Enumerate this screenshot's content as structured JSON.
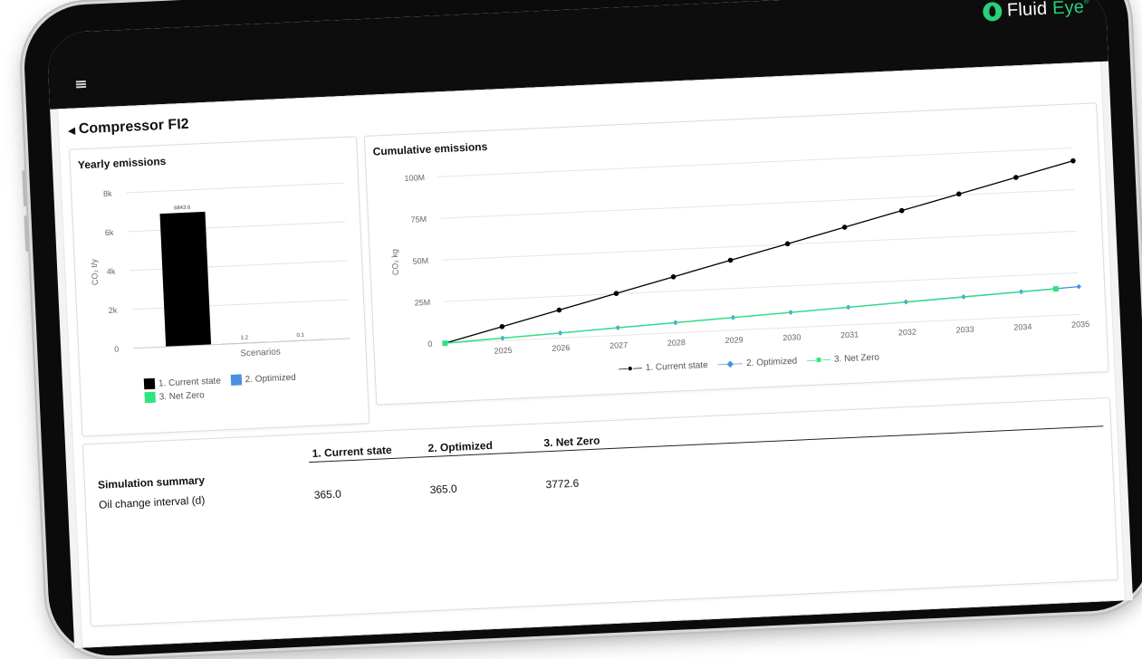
{
  "header": {
    "brand_a": "Fluid ",
    "brand_b": "Eye",
    "brand_reg": "®",
    "menu_icon": "hamburger-icon"
  },
  "page": {
    "title": "Compressor FI2",
    "collapse_icon": "triangle-left-icon"
  },
  "yearly": {
    "title": "Yearly emissions",
    "xaxis_label": "Scenarios",
    "yaxis_label": "CO₂ t/y",
    "legend": [
      "1. Current state",
      "2. Optimized",
      "3. Net Zero"
    ]
  },
  "cumulative": {
    "title": "Cumulative emissions",
    "yaxis_label": "CO₂ kg",
    "legend": [
      "1. Current state",
      "2. Optimized",
      "3. Net Zero"
    ]
  },
  "summary": {
    "title": "Simulation summary",
    "columns": [
      "1. Current state",
      "2. Optimized",
      "3. Net Zero"
    ],
    "rows": [
      {
        "label": "Oil change interval (d)",
        "values": [
          "365.0",
          "365.0",
          "3772.6"
        ]
      }
    ]
  },
  "colors": {
    "current": "#000000",
    "optimized": "#4a90e2",
    "netzero": "#2ee57f",
    "brand_green": "#27d07a"
  },
  "chart_data": [
    {
      "type": "bar",
      "title": "Yearly emissions",
      "xlabel": "Scenarios",
      "ylabel": "CO₂ t/y",
      "categories": [
        "Scenarios"
      ],
      "series": [
        {
          "name": "1. Current state",
          "values": [
            6843.6
          ],
          "label": "6843.6"
        },
        {
          "name": "2. Optimized",
          "values": [
            1.2
          ],
          "label": "1.2"
        },
        {
          "name": "3. Net Zero",
          "values": [
            0.1
          ],
          "label": "0.1"
        }
      ],
      "ylim": [
        0,
        8000
      ],
      "yticks": [
        0,
        2000,
        4000,
        6000,
        8000
      ],
      "ytick_labels": [
        "0",
        "2k",
        "4k",
        "6k",
        "8k"
      ],
      "grid": true,
      "legend_position": "bottom"
    },
    {
      "type": "line",
      "title": "Cumulative emissions",
      "ylabel": "CO₂ kg",
      "x": [
        2024,
        2025,
        2026,
        2027,
        2028,
        2029,
        2030,
        2031,
        2032,
        2033,
        2034,
        2035
      ],
      "xtick_labels": [
        "2025",
        "2026",
        "2027",
        "2028",
        "2029",
        "2030",
        "2031",
        "2032",
        "2033",
        "2034",
        "2035"
      ],
      "series": [
        {
          "name": "1. Current state",
          "values": [
            0,
            8.4,
            16.8,
            25.2,
            33.6,
            42.0,
            50.3,
            58.7,
            67.1,
            75.5,
            83.9,
            92.3
          ]
        },
        {
          "name": "2. Optimized",
          "values": [
            0,
            1.5,
            3.0,
            4.6,
            6.1,
            7.6,
            9.1,
            10.6,
            12.2,
            13.7,
            15.2,
            16.7
          ]
        },
        {
          "name": "3. Net Zero",
          "x": [
            2024,
            2034.6
          ],
          "values": [
            0,
            16.0
          ]
        }
      ],
      "ylim": [
        0,
        100
      ],
      "yticks": [
        0,
        25,
        50,
        75,
        100
      ],
      "ytick_labels": [
        "0",
        "25M",
        "50M",
        "75M",
        "100M"
      ],
      "yunit": "M",
      "grid": true,
      "legend_position": "bottom"
    }
  ]
}
